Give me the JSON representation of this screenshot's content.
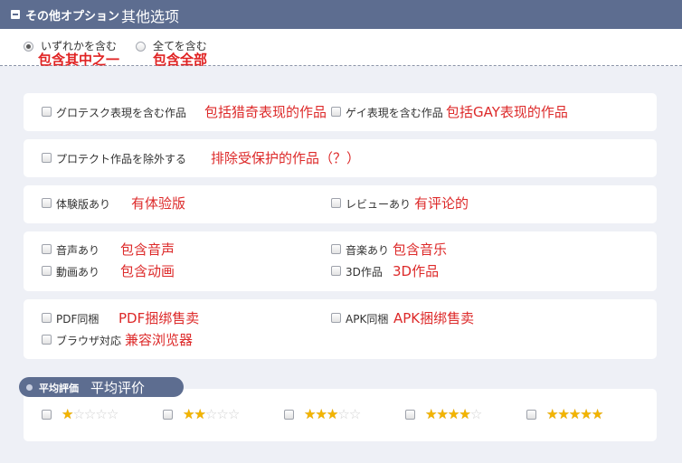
{
  "header": {
    "title_jp": "その他オプション",
    "title_cn": "其他选项"
  },
  "match_mode": {
    "options": [
      {
        "label_jp": "いずれかを含む",
        "label_cn": "包含其中之一",
        "selected": true
      },
      {
        "label_jp": "全てを含む",
        "label_cn": "包含全部",
        "selected": false
      }
    ]
  },
  "filters": {
    "grotesque": {
      "jp": "グロテスク表現を含む作品",
      "cn": "包括猎奇表现的作品"
    },
    "gay": {
      "jp": "ゲイ表現を含む作品",
      "cn": "包括GAY表现的作品"
    },
    "protect": {
      "jp": "プロテクト作品を除外する",
      "cn": "排除受保护的作品（？）"
    },
    "trial": {
      "jp": "体験版あり",
      "cn": "有体验版"
    },
    "review": {
      "jp": "レビューあり",
      "cn": "有评论的"
    },
    "voice": {
      "jp": "音声あり",
      "cn": "包含音声"
    },
    "music": {
      "jp": "音楽あり",
      "cn": "包含音乐"
    },
    "video": {
      "jp": "動画あり",
      "cn": "包含动画"
    },
    "3d": {
      "jp": "3D作品",
      "cn": "3D作品"
    },
    "pdf": {
      "jp": "PDF同梱",
      "cn": "PDF捆绑售卖"
    },
    "apk": {
      "jp": "APK同梱",
      "cn": "APK捆绑售卖"
    },
    "browser": {
      "jp": "ブラウザ対応",
      "cn": "兼容浏览器"
    }
  },
  "rating": {
    "title_jp": "平均評価",
    "title_cn": "平均评价",
    "levels": [
      1,
      2,
      3,
      4,
      5
    ],
    "max": 5,
    "colors": {
      "on": "#f3b400",
      "off": "#d2d2d2"
    }
  },
  "colors": {
    "header_bg": "#5d6d90",
    "page_bg": "#eef0f6",
    "accent_red": "#dd2a2a"
  }
}
